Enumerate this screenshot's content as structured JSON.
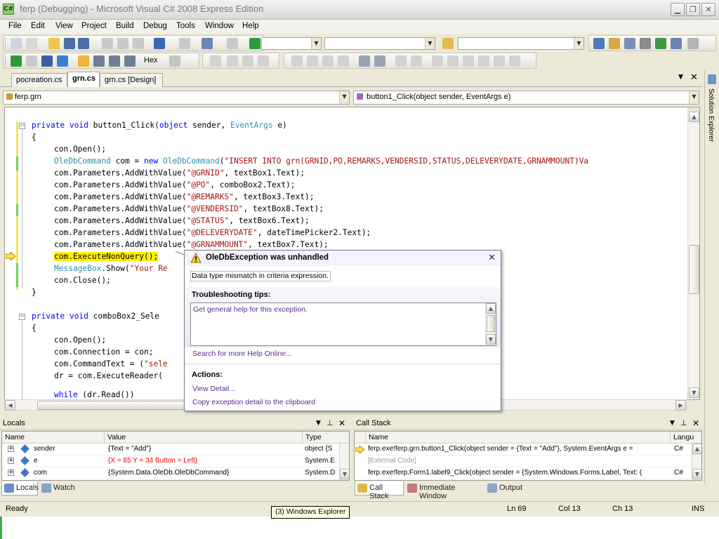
{
  "window": {
    "title": "ferp (Debugging) - Microsoft Visual C# 2008 Express Edition",
    "icon": "C#"
  },
  "menu": [
    "File",
    "Edit",
    "View",
    "Project",
    "Build",
    "Debug",
    "Tools",
    "Window",
    "Help"
  ],
  "debug_toolbar": {
    "hex_label": "Hex"
  },
  "tabs": [
    {
      "label": "pocreation.cs",
      "active": false
    },
    {
      "label": "grn.cs",
      "active": true
    },
    {
      "label": "grn.cs [Design]",
      "active": false
    }
  ],
  "nav": {
    "class_combo": "ferp.grn",
    "member_combo": "button1_Click(object sender, EventArgs e)"
  },
  "code": {
    "l1": [
      "private",
      " ",
      "void",
      " button1_Click(",
      "object",
      " sender, ",
      "EventArgs",
      " e)"
    ],
    "l2": "{",
    "l3": "con.Open();",
    "l4": [
      "OleDbCommand",
      " com = ",
      "new",
      " ",
      "OleDbCommand",
      "(",
      "\"INSERT INTO grn(GRNID,PO,REMARKS,VENDERSID,STATUS,DELEVERYDATE,GRNAMMOUNT)Va"
    ],
    "params": [
      [
        "com.Parameters.AddWithValue(",
        "\"@GRNID\"",
        ", textBox1.Text);"
      ],
      [
        "com.Parameters.AddWithValue(",
        "\"@PO\"",
        ", comboBox2.Text);"
      ],
      [
        "com.Parameters.AddWithValue(",
        "\"@REMARKS\"",
        ", textBox3.Text);"
      ],
      [
        "com.Parameters.AddWithValue(",
        "\"@VENDERSID\"",
        ", textBox8.Text);"
      ],
      [
        "com.Parameters.AddWithValue(",
        "\"@STATUS\"",
        ", textBox6.Text);"
      ],
      [
        "com.Parameters.AddWithValue(",
        "\"@DELEVERYDATE\"",
        ", dateTimePicker2.Text);"
      ],
      [
        "com.Parameters.AddWithValue(",
        "\"@GRNAMMOUNT\"",
        ", textBox7.Text);"
      ]
    ],
    "exec": "com.ExecuteNonQuery();",
    "msgbox": [
      "MessageBox",
      ".Show(",
      "\"Your Re"
    ],
    "close": "con.Close();",
    "endbrace": "}",
    "m2": [
      "private",
      " ",
      "void",
      " comboBox2_Sele"
    ],
    "m2brace": "{",
    "m2l1": "con.Open();",
    "m2l2": "com.Connection = con;",
    "m2l3": [
      "com.CommandText = (",
      "\"sele"
    ],
    "m2l4": "dr = com.ExecuteReader(",
    "m2l5": [
      "while",
      " (dr.Read())"
    ]
  },
  "exception": {
    "title": "OleDbException was unhandled",
    "message": "Data type mismatch in criteria expression.",
    "tips_label": "Troubleshooting tips:",
    "tip": "Get general help for this exception.",
    "search_link": "Search for more Help Online...",
    "actions_label": "Actions:",
    "view_detail": "View Detail...",
    "copy_detail": "Copy exception detail to the clipboard"
  },
  "locals": {
    "title": "Locals",
    "columns": [
      "Name",
      "Value",
      "Type"
    ],
    "rows": [
      {
        "name": "sender",
        "value": "{Text = \"Add\"}",
        "type": "object {S",
        "changed": false
      },
      {
        "name": "e",
        "value": "{X = 85 Y = 34 Button = Left}",
        "type": "System.E",
        "changed": true
      },
      {
        "name": "com",
        "value": "{System.Data.OleDb.OleDbCommand}",
        "type": "System.D",
        "changed": false
      }
    ],
    "tabs": [
      "Locals",
      "Watch"
    ]
  },
  "callstack": {
    "title": "Call Stack",
    "columns": [
      "Name",
      "Langu"
    ],
    "rows": [
      {
        "name": "ferp.exe!ferp.grn.button1_Click(object sender = {Text = \"Add\"}, System.EventArgs e =",
        "lang": "C#",
        "current": true
      },
      {
        "name": "[External Code]",
        "lang": "",
        "current": false
      },
      {
        "name": "ferp.exe!ferp.Form1.label9_Click(object sender = {System.Windows.Forms.Label, Text: (",
        "lang": "C#",
        "current": false
      }
    ],
    "tabs": [
      "Call Stack",
      "Immediate Window",
      "Output"
    ]
  },
  "status": {
    "ready": "Ready",
    "ln": "Ln 69",
    "col": "Col 13",
    "ch": "Ch 13",
    "ins": "INS"
  },
  "tooltip": "(3) Windows Explorer",
  "solution_explorer": "Solution Explorer",
  "colors": {
    "keyword": "#0000ff",
    "type": "#2b91af",
    "string": "#a31515",
    "highlight": "#ffef00",
    "link": "#5b2b8b",
    "changed_value": "#ff0000"
  }
}
